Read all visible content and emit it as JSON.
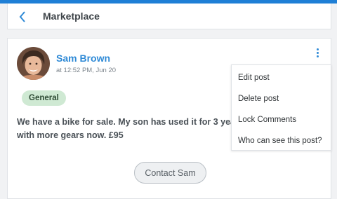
{
  "header": {
    "title": "Marketplace",
    "back_icon": "chevron-left-icon"
  },
  "post": {
    "author": "Sam Brown",
    "timestamp": "at 12:52 PM, Jun 20",
    "tag": "General",
    "text_line1": "We have a bike for sale. My son has used it for 3 years",
    "text_line2": "with more gears now. £95",
    "contact_label": "Contact Sam"
  },
  "menu": {
    "items": [
      "Edit post",
      "Delete post",
      "Lock Comments",
      "Who can see this post?"
    ]
  },
  "colors": {
    "accent": "#1f7fd6",
    "link": "#2f8ad6",
    "tag_bg": "#cfe9d3"
  }
}
